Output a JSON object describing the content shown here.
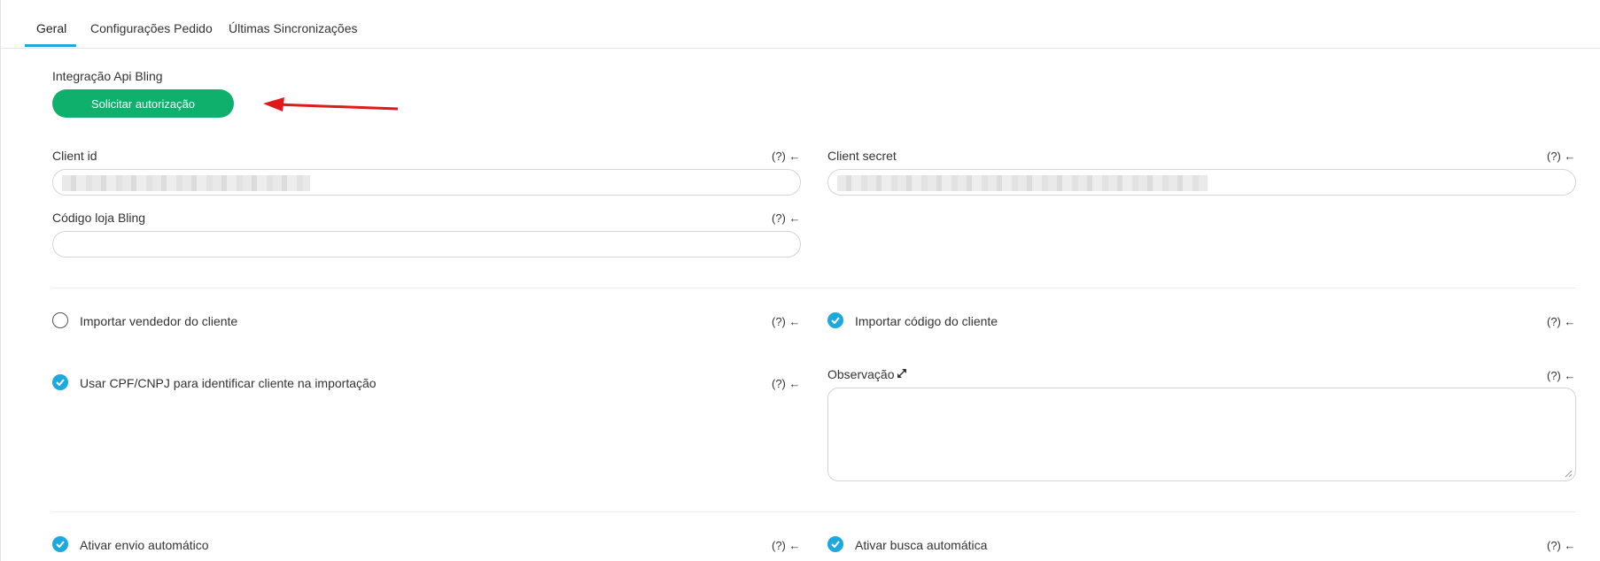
{
  "tabs": [
    {
      "label": "Geral",
      "active": true
    },
    {
      "label": "Configurações Pedido",
      "active": false
    },
    {
      "label": "Últimas Sincronizações",
      "active": false
    }
  ],
  "integration": {
    "title": "Integração Api Bling",
    "button_label": "Solicitar autorização"
  },
  "fields": {
    "client_id": {
      "label": "Client id",
      "help": "(?) ←"
    },
    "client_secret": {
      "label": "Client secret",
      "help": "(?) ←"
    },
    "codigo_loja": {
      "label": "Código loja Bling",
      "help": "(?) ←"
    }
  },
  "options": {
    "importar_vendedor": {
      "label": "Importar vendedor do cliente",
      "checked": false,
      "help": "(?) ←"
    },
    "importar_codigo": {
      "label": "Importar código do cliente",
      "checked": true,
      "help": "(?) ←"
    },
    "usar_cpf": {
      "label": "Usar CPF/CNPJ para identificar cliente na importação",
      "checked": true,
      "help": "(?) ←"
    },
    "observacao": {
      "label": "Observação",
      "help": "(?) ←"
    },
    "envio_auto": {
      "label": "Ativar envio automático",
      "checked": true,
      "help": "(?) ←"
    },
    "busca_auto": {
      "label": "Ativar busca automática",
      "checked": true,
      "help": "(?) ←"
    }
  },
  "colors": {
    "accent": "#1ea8e0",
    "button": "#0fb06b",
    "arrow": "#e0191b"
  },
  "icons": {
    "expand": "expand-icon",
    "arrow": "red-arrow-annotation"
  }
}
